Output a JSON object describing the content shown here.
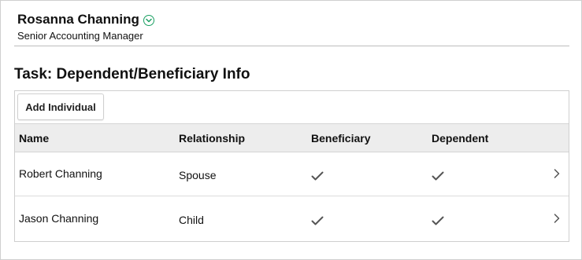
{
  "person": {
    "name": "Rosanna Channing",
    "title": "Senior Accounting Manager",
    "menu_icon": "chevron-down-circle-icon",
    "accent": "#1a9f62"
  },
  "task": {
    "title": "Task: Dependent/Beneficiary Info"
  },
  "toolbar": {
    "add_label": "Add Individual"
  },
  "table": {
    "columns": [
      "Name",
      "Relationship",
      "Beneficiary",
      "Dependent"
    ],
    "rows": [
      {
        "name": "Robert Channing",
        "relationship": "Spouse",
        "beneficiary": true,
        "dependent": true
      },
      {
        "name": "Jason Channing",
        "relationship": "Child",
        "beneficiary": true,
        "dependent": true
      }
    ],
    "check_icon": "checkmark-icon",
    "row_action_icon": "chevron-right-icon"
  }
}
